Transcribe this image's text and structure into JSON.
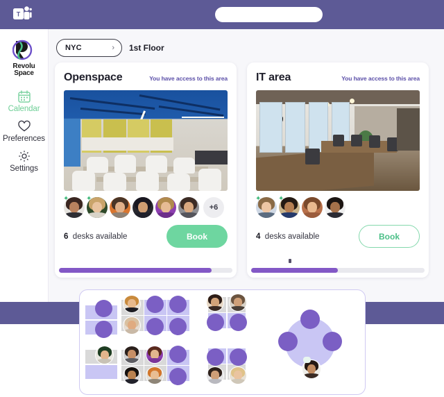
{
  "teams": {
    "logo_icon": "microsoft-teams-icon",
    "search_placeholder": ""
  },
  "sidebar": {
    "brand": {
      "name_line1": "Revolu",
      "name_line2": "Space",
      "logo_icon": "revoluspace-logo"
    },
    "items": [
      {
        "label": "Calendar",
        "icon": "calendar-icon",
        "active": true
      },
      {
        "label": "Preferences",
        "icon": "heart-icon",
        "active": false
      },
      {
        "label": "Settings",
        "icon": "gear-icon",
        "active": false
      }
    ]
  },
  "toolbar": {
    "location": "NYC",
    "location_chevron": "chevron-right-icon",
    "floor": "1st Floor"
  },
  "cards": [
    {
      "title": "Openspace",
      "access_note": "You have access to this area",
      "photo_alt": "openspace-photo",
      "avatars": [
        {
          "starred": true
        },
        {
          "starred": true
        },
        {
          "starred": false
        },
        {
          "starred": false
        },
        {
          "starred": false
        },
        {
          "starred": false
        }
      ],
      "overflow_label": "+6",
      "desks_count": "6",
      "desks_text": "desks available",
      "book_label": "Book",
      "book_style": "filled",
      "scroll_percent": 88
    },
    {
      "title": "IT area",
      "access_note": "You have access to this area",
      "photo_alt": "it-area-photo",
      "avatars": [
        {
          "starred": true
        },
        {
          "starred": true
        },
        {
          "starred": false
        },
        {
          "starred": false
        }
      ],
      "overflow_label": "",
      "desks_count": "4",
      "desks_text": "desks available",
      "book_label": "Book",
      "book_style": "outline",
      "scroll_percent": 50
    }
  ],
  "floorplan": {
    "name": "floor-plan-overlay",
    "free_seat_count": 16,
    "occupied_seat_count": 13
  },
  "colors": {
    "teams_purple": "#5d5a96",
    "accent_green": "#6ed6a0",
    "seat_purple": "#7b5fc4",
    "desk_lilac": "#c9c6f4",
    "access_text": "#5b4fa8",
    "scroll_thumb": "#8358c6"
  }
}
